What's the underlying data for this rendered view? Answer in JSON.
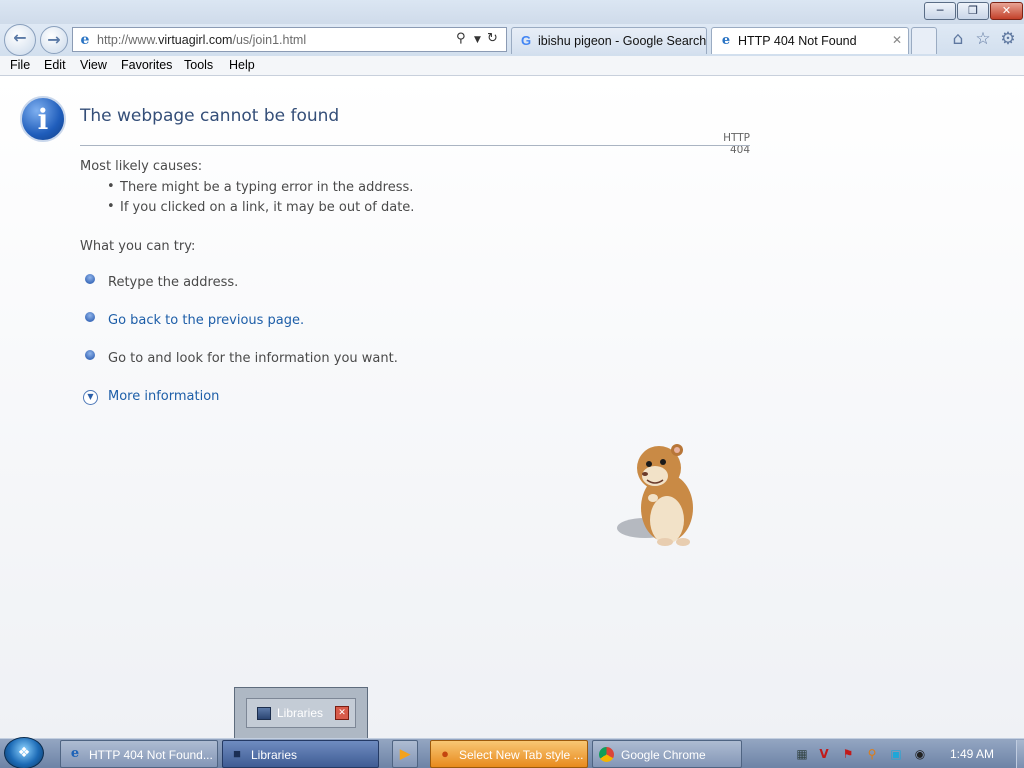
{
  "window": {
    "minimize_icon": "minimize-icon",
    "maximize_icon": "restore-icon",
    "close_icon": "close-icon"
  },
  "nav": {
    "url_prefix": "http://www.",
    "url_domain": "virtuagirl.com",
    "url_path": "/us/join1.html"
  },
  "tabs": [
    {
      "label": "ibishu pigeon - Google Search",
      "icon": "google-icon"
    },
    {
      "label": "HTTP 404 Not Found",
      "icon": "ie-icon",
      "active": true
    }
  ],
  "menu": [
    "File",
    "Edit",
    "View",
    "Favorites",
    "Tools",
    "Help"
  ],
  "page": {
    "title": "The webpage cannot be found",
    "code": "HTTP 404",
    "causes_heading": "Most likely causes:",
    "causes": [
      "There might be a typing error in the address.",
      "If you clicked on a link, it may be out of date."
    ],
    "try_heading": "What you can try:",
    "tries": [
      "Retype the address.",
      "Go back to the previous page.",
      "Go to  and look for the information you want."
    ],
    "more_info": "More information"
  },
  "popup": {
    "label": "Libraries"
  },
  "taskbar": {
    "items": [
      {
        "label": "HTTP 404 Not Found...",
        "icon": "ie-icon"
      },
      {
        "label": "Libraries",
        "icon": "libraries-icon"
      },
      {
        "label": "",
        "icon": "media-player-icon"
      },
      {
        "label": "Select New Tab style ...",
        "icon": "app-icon"
      },
      {
        "label": "Google Chrome",
        "icon": "chrome-icon"
      }
    ],
    "clock": "1:49 AM"
  },
  "colors": {
    "accent": "#1d5ea8",
    "title": "#344e78",
    "taskbar": "#7d91b2"
  }
}
